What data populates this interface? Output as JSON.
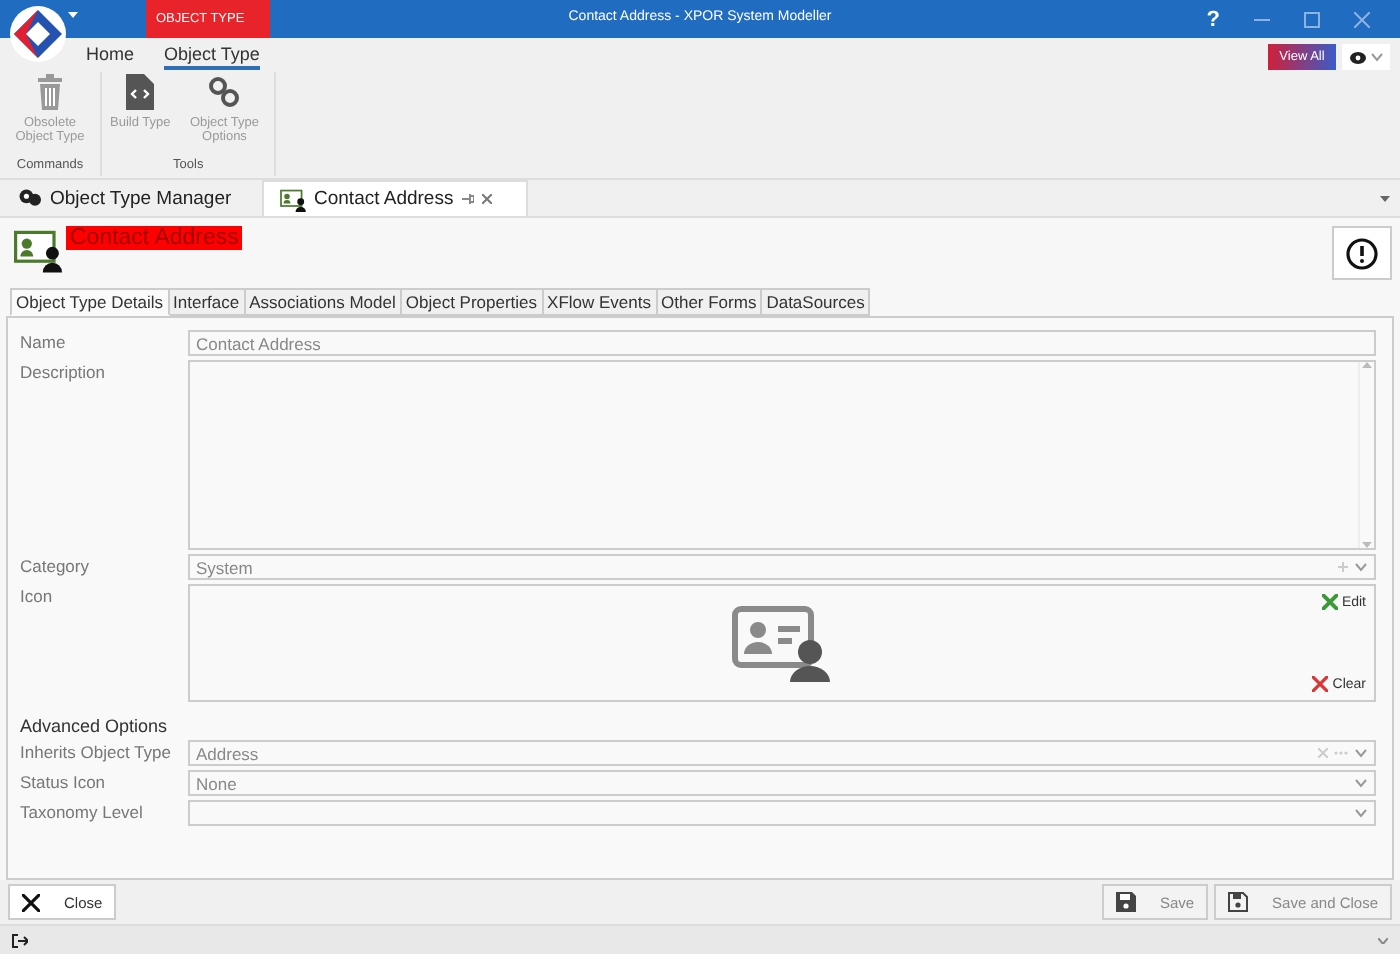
{
  "window": {
    "title": "Contact Address - XPOR System Modeller",
    "context_tab": "OBJECT TYPE",
    "help": "?"
  },
  "ribbon": {
    "tabs": [
      {
        "label": "Home",
        "selected": false
      },
      {
        "label": "Object Type",
        "selected": true
      }
    ],
    "view_all": "View All",
    "groups": [
      {
        "label": "Commands",
        "buttons": [
          {
            "label": "Obsolete Object Type",
            "kind": "trash",
            "disabled": true
          }
        ]
      },
      {
        "label": "Tools",
        "buttons": [
          {
            "label": "Build Type",
            "kind": "build",
            "disabled": true
          },
          {
            "label": "Object Type Options",
            "kind": "gears",
            "disabled": true
          }
        ]
      }
    ]
  },
  "doc_tabs": [
    {
      "label": "Object Type Manager",
      "kind": "manager",
      "selected": false
    },
    {
      "label": "Contact Address",
      "kind": "contact",
      "selected": true
    }
  ],
  "header": {
    "title": "Contact Address"
  },
  "form_tabs": [
    {
      "label": "Object Type Details",
      "selected": true
    },
    {
      "label": "Interface",
      "selected": false
    },
    {
      "label": "Associations Model",
      "selected": false
    },
    {
      "label": "Object Properties",
      "selected": false
    },
    {
      "label": "XFlow Events",
      "selected": false
    },
    {
      "label": "Other Forms",
      "selected": false
    },
    {
      "label": "DataSources",
      "selected": false
    }
  ],
  "fields": [
    {
      "label": "Name",
      "kind": "text",
      "value": "Contact Address"
    },
    {
      "label": "Description",
      "kind": "memo"
    },
    {
      "label": "Category",
      "kind": "picker",
      "value": "System"
    },
    {
      "label": "Icon",
      "kind": "image",
      "edit": "Edit",
      "clear": "Clear"
    }
  ],
  "advanced": {
    "title": "Advanced Options",
    "fields": [
      {
        "label": "Inherits Object Type",
        "kind": "lookup",
        "value": "Address"
      },
      {
        "label": "Status Icon",
        "kind": "combo",
        "value": "None"
      },
      {
        "label": "Taxonomy Level",
        "kind": "combo"
      }
    ]
  },
  "footer": {
    "close": "Close",
    "save": "Save",
    "save_close": "Save and Close"
  }
}
